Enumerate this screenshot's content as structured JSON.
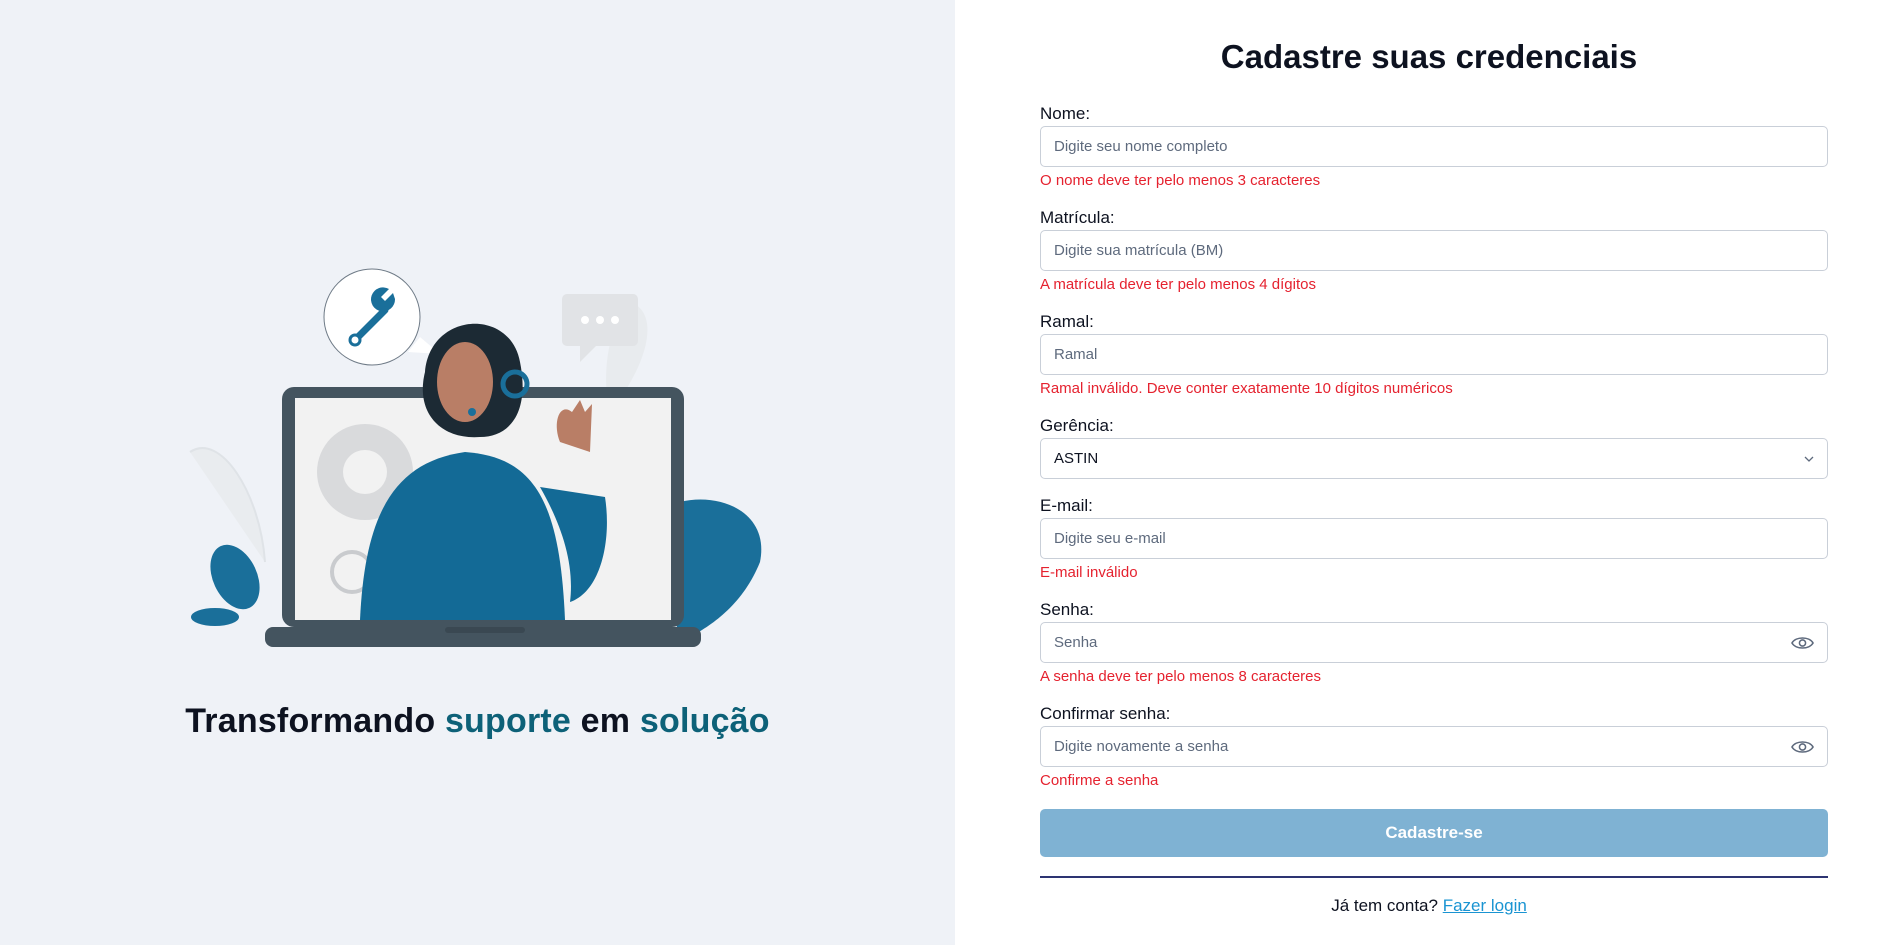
{
  "left": {
    "tagline_part1": "Transformando ",
    "tagline_part2": "suporte",
    "tagline_part3": " em ",
    "tagline_part4": "solução"
  },
  "form": {
    "title": "Cadastre suas credenciais",
    "nome": {
      "label": "Nome:",
      "placeholder": "Digite seu nome completo",
      "error": "O nome deve ter pelo menos 3 caracteres"
    },
    "matricula": {
      "label": "Matrícula:",
      "placeholder": "Digite sua matrícula (BM)",
      "error": "A matrícula deve ter pelo menos 4 dígitos"
    },
    "ramal": {
      "label": "Ramal:",
      "placeholder": "Ramal",
      "error": "Ramal inválido. Deve conter exatamente 10 dígitos numéricos"
    },
    "gerencia": {
      "label": "Gerência:",
      "selected": "ASTIN"
    },
    "email": {
      "label": "E-mail:",
      "placeholder": "Digite seu e-mail",
      "error": "E-mail inválido"
    },
    "senha": {
      "label": "Senha:",
      "placeholder": "Senha",
      "error": "A senha deve ter pelo menos 8 caracteres"
    },
    "confirmar": {
      "label": "Confirmar senha:",
      "placeholder": "Digite novamente a senha",
      "error": "Confirme a senha"
    },
    "submit_label": "Cadastre-se",
    "login_prompt": "Já tem conta? ",
    "login_link": "Fazer login"
  },
  "colors": {
    "left_bg": "#eff2f7",
    "accent_teal": "#0d6178",
    "error": "#e5222f",
    "button_disabled": "#7fb2d3",
    "link": "#1a94d2"
  },
  "icons": [
    "wrench-icon",
    "chat-bubble-icon",
    "chevron-down-icon",
    "eye-icon"
  ]
}
